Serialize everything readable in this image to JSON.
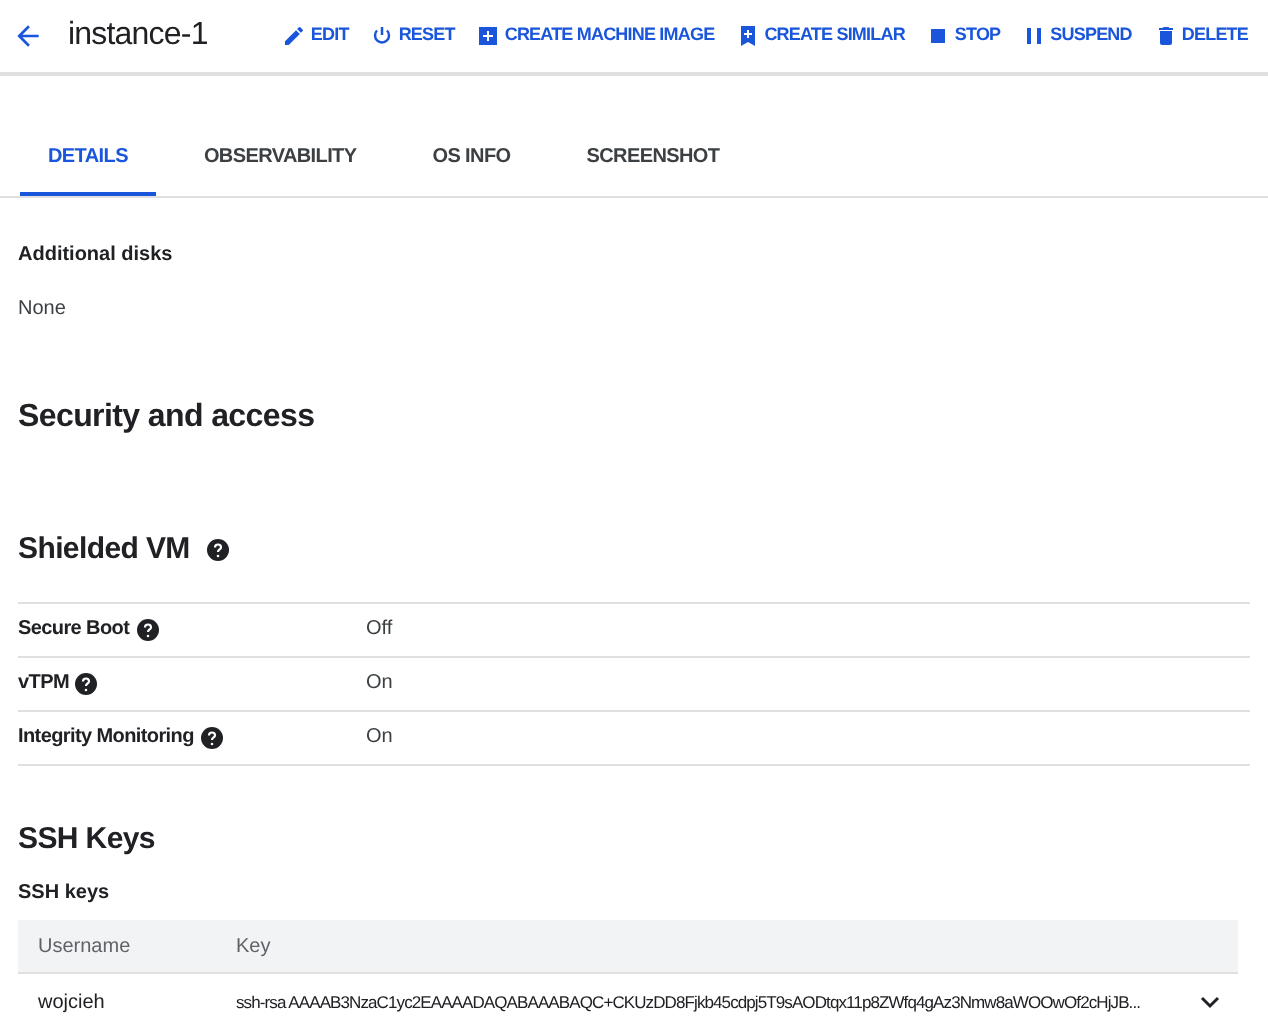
{
  "header": {
    "title": "instance-1",
    "actions": [
      {
        "kind": "edit",
        "label": "EDIT"
      },
      {
        "kind": "reset",
        "label": "RESET"
      },
      {
        "kind": "machine-image",
        "label": "CREATE MACHINE IMAGE"
      },
      {
        "kind": "similar",
        "label": "CREATE SIMILAR"
      },
      {
        "kind": "stop",
        "label": "STOP"
      },
      {
        "kind": "suspend",
        "label": "SUSPEND"
      },
      {
        "kind": "delete",
        "label": "DELETE"
      }
    ]
  },
  "tabs": [
    {
      "label": "DETAILS",
      "selected": true
    },
    {
      "label": "OBSERVABILITY",
      "selected": false
    },
    {
      "label": "OS INFO",
      "selected": false
    },
    {
      "label": "SCREENSHOT",
      "selected": false
    }
  ],
  "additional_disks": {
    "label": "Additional disks",
    "value": "None"
  },
  "security_heading": "Security and access",
  "shielded_vm": {
    "heading": "Shielded VM",
    "rows": [
      {
        "label": "Secure Boot",
        "value": "Off"
      },
      {
        "label": "vTPM",
        "value": "On"
      },
      {
        "label": "Integrity Monitoring",
        "value": "On"
      }
    ]
  },
  "ssh": {
    "heading": "SSH Keys",
    "subheading": "SSH keys",
    "columns": [
      "Username",
      "Key"
    ],
    "rows": [
      {
        "username": "wojcieh",
        "key": "ssh-rsa AAAAB3NzaC1yc2EAAAADAQABAAABAQC+CKUzDD8Fjkb45cdpj5T9sAODtqx11p8ZWfq4gAz3Nmw8aWOOwOf2cHjJB..."
      }
    ]
  }
}
